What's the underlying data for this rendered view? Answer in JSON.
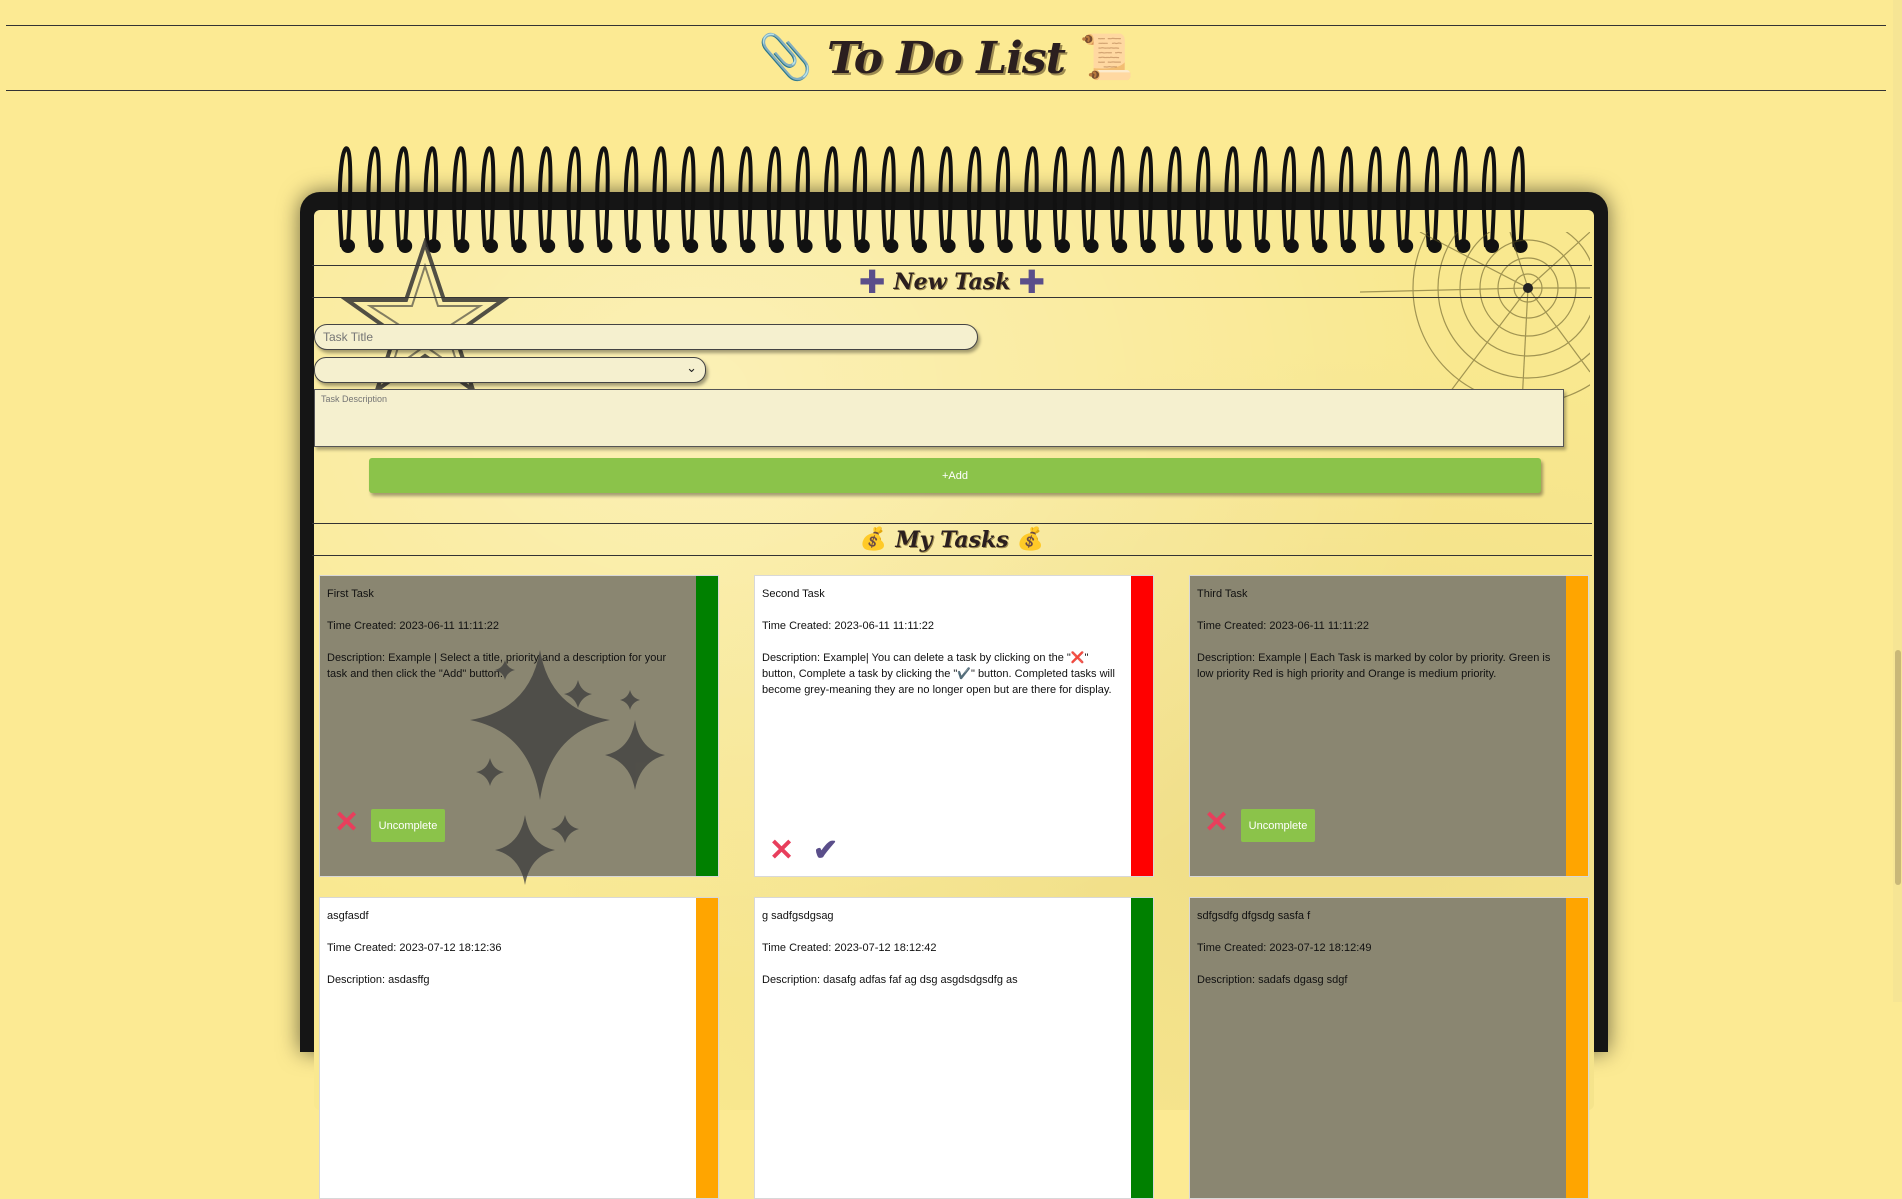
{
  "header": {
    "title": "To Do List",
    "left_icon": "paperclip-icon",
    "right_icon": "scroll-icon"
  },
  "new_task": {
    "heading": "New Task",
    "title_placeholder": "Task Title",
    "priority_value": "",
    "description_placeholder": "Task Description",
    "add_label": "+Add"
  },
  "my_tasks": {
    "heading": "My Tasks",
    "uncomplete_label": "Uncomplete",
    "tasks": [
      {
        "title": "First Task",
        "time": "Time Created: 2023-06-11 11:11:22",
        "description": "Description: Example | Select a title, priority and a description for your task and then click the \"Add\" button.",
        "priority": "green",
        "completed": true
      },
      {
        "title": "Second Task",
        "time": "Time Created: 2023-06-11 11:11:22",
        "description": "Description: Example| You can delete a task by clicking on the \"❌\" button, Complete a task by clicking the \"✔️\" button. Completed tasks will become grey-meaning they are no longer open but are there for display.",
        "priority": "red",
        "completed": false
      },
      {
        "title": "Third Task",
        "time": "Time Created: 2023-06-11 11:11:22",
        "description": "Description: Example | Each Task is marked by color by priority. Green is low priority Red is high priority and Orange is medium priority.",
        "priority": "orange",
        "completed": true
      },
      {
        "title": "asgfasdf",
        "time": "Time Created: 2023-07-12 18:12:36",
        "description": "Description: asdasffg",
        "priority": "orange",
        "completed": false
      },
      {
        "title": "g sadfgsdgsag",
        "time": "Time Created: 2023-07-12 18:12:42",
        "description": "Description: dasafg adfas faf ag dsg asgdsdgsdfg as",
        "priority": "green",
        "completed": false
      },
      {
        "title": "sdfgsdfg dfgsdg sasfa f",
        "time": "Time Created: 2023-07-12 18:12:49",
        "description": "Description: sadafs dgasg sdgf",
        "priority": "orange",
        "completed": true
      }
    ]
  },
  "colors": {
    "background": "#fcea93",
    "accent_green": "#8bc34a",
    "priority_green": "#008000",
    "priority_red": "#ff0000",
    "priority_orange": "#ffa500",
    "completed_card": "#8a8671",
    "delete_icon": "#e83e5c",
    "check_icon": "#5a4e8a"
  }
}
